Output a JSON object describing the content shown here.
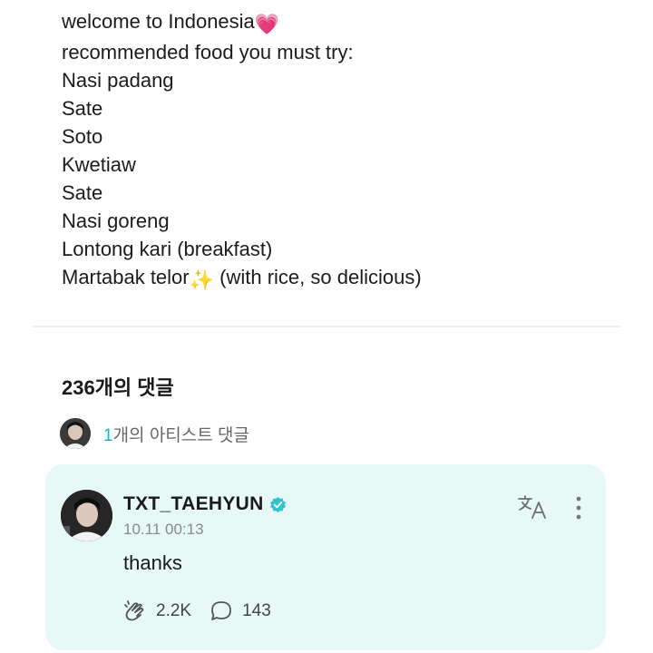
{
  "post": {
    "lines": [
      {
        "text": "welcome to Indonesia",
        "emoji": "💗"
      },
      {
        "text": "recommended food you must try:"
      },
      {
        "text": "Nasi padang"
      },
      {
        "text": "Sate"
      },
      {
        "text": "Soto"
      },
      {
        "text": "Kwetiaw"
      },
      {
        "text": "Sate"
      },
      {
        "text": "Nasi goreng"
      },
      {
        "text": "Lontong kari (breakfast)"
      },
      {
        "text": "Martabak telor",
        "emoji": "✨",
        "suffix": " (with rice, so delicious)"
      }
    ]
  },
  "comments": {
    "count_label": "236개의 댓글",
    "artist_count": "1",
    "artist_label": "개의 아티스트 댓글"
  },
  "artist_comment": {
    "username": "TXT_TAEHYUN",
    "timestamp": "10.11 00:13",
    "text": "thanks",
    "likes": "2.2K",
    "replies": "143"
  },
  "icons": {
    "avatar": "avatar",
    "verified": "verified-badge-icon",
    "translate": "translate-icon",
    "more": "more-vertical-icon",
    "like": "cheer-hand-icon",
    "reply": "comment-bubble-icon"
  },
  "colors": {
    "accent": "#13b8c0",
    "card_bg": "#e6f9f7",
    "verified": "#2ec4cf"
  }
}
